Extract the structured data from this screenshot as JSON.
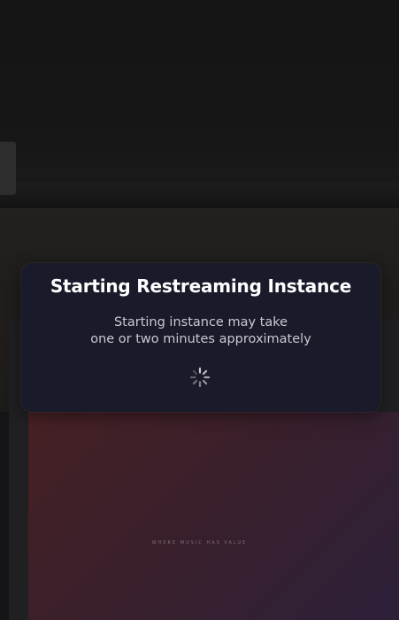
{
  "dialog": {
    "title": "Starting Restreaming Instance",
    "message_line1": "Starting instance may take",
    "message_line2": "one or two minutes approximately",
    "icon": "loading-spinner-icon"
  },
  "background": {
    "tagline": "WHERE MUSIC HAS VALUE"
  },
  "colors": {
    "dialog_bg": "#191a2a",
    "title": "#ffffff",
    "message": "#c9c9d2",
    "spinner": "#c8c8d0"
  }
}
